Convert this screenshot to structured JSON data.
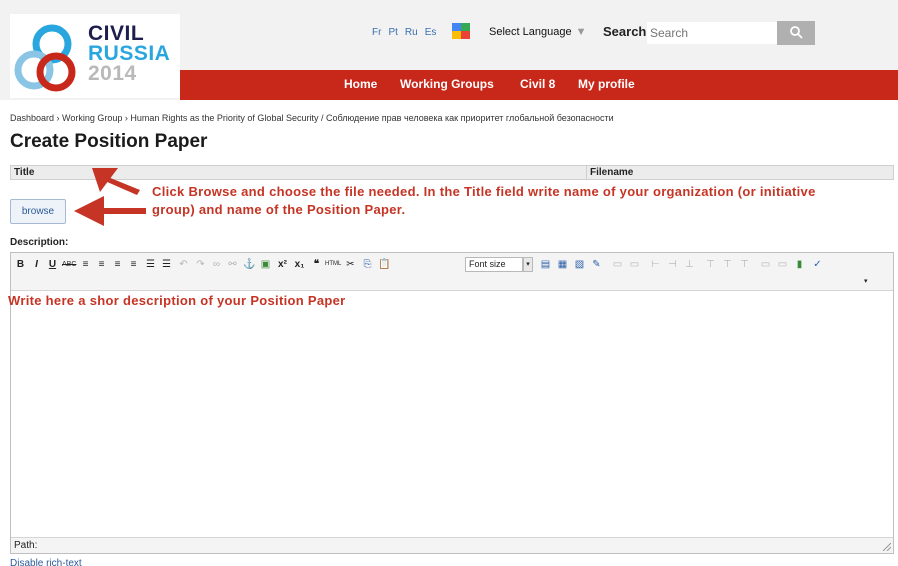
{
  "header": {
    "logo": {
      "line1": "CIVIL",
      "line2": "RUSSIA",
      "line3": "2014"
    },
    "languages": [
      "Fr",
      "Pt",
      "Ru",
      "Es"
    ],
    "language_select": "Select Language",
    "language_select_arrow": "▼",
    "search_label": "Search:",
    "search_placeholder": "Search",
    "nav": [
      "Home",
      "Working Groups",
      "Civil 8",
      "My profile"
    ]
  },
  "breadcrumb": "Dashboard › Working Group › Human Rights as the Priority of Global Security / Соблюдение прав человека как приоритет глобальной безопасности",
  "page_title": "Create Position Paper",
  "columns": {
    "title": "Title",
    "filename": "Filename"
  },
  "browse_label": "browse",
  "annotations": {
    "browse": "Click Browse and choose the file needed. In the Title field write name of your organization (or initiative group) and name of the Position Paper.",
    "description": "Write here a shor description of your Position Paper"
  },
  "description_label": "Description:",
  "editor": {
    "font_size_label": "Font size",
    "path_label": "Path:"
  },
  "disable_rich_text": "Disable rich-text",
  "colors": {
    "accent_red": "#c8281a",
    "annotation_red": "#c53424",
    "link_blue": "#2a5a9a"
  }
}
